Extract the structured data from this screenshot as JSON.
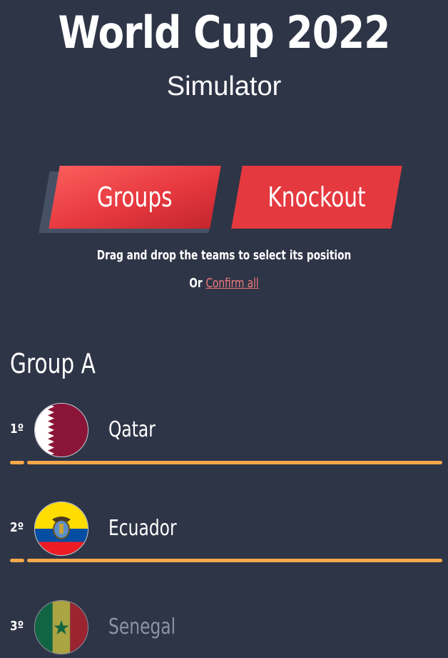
{
  "header": {
    "title": "World Cup 2022",
    "subtitle": "Simulator"
  },
  "tabs": [
    {
      "label": "Groups",
      "active": true
    },
    {
      "label": "Knockout",
      "active": false
    }
  ],
  "instructions": {
    "text": "Drag and drop the teams to select its position",
    "confirm_prefix": "Or",
    "confirm_link": "Confirm all"
  },
  "group": {
    "title": "Group A",
    "teams": [
      {
        "position": "1º",
        "name": "Qatar",
        "flag": "qatar-flag",
        "confirmed": true
      },
      {
        "position": "2º",
        "name": "Ecuador",
        "flag": "ecuador-flag",
        "confirmed": true
      },
      {
        "position": "3º",
        "name": "Senegal",
        "flag": "senegal-flag",
        "confirmed": false
      }
    ]
  },
  "colors": {
    "background": "#2e3547",
    "tab_red": "#e4393f",
    "separator": "#f7a84a",
    "link": "#f07a7a"
  }
}
